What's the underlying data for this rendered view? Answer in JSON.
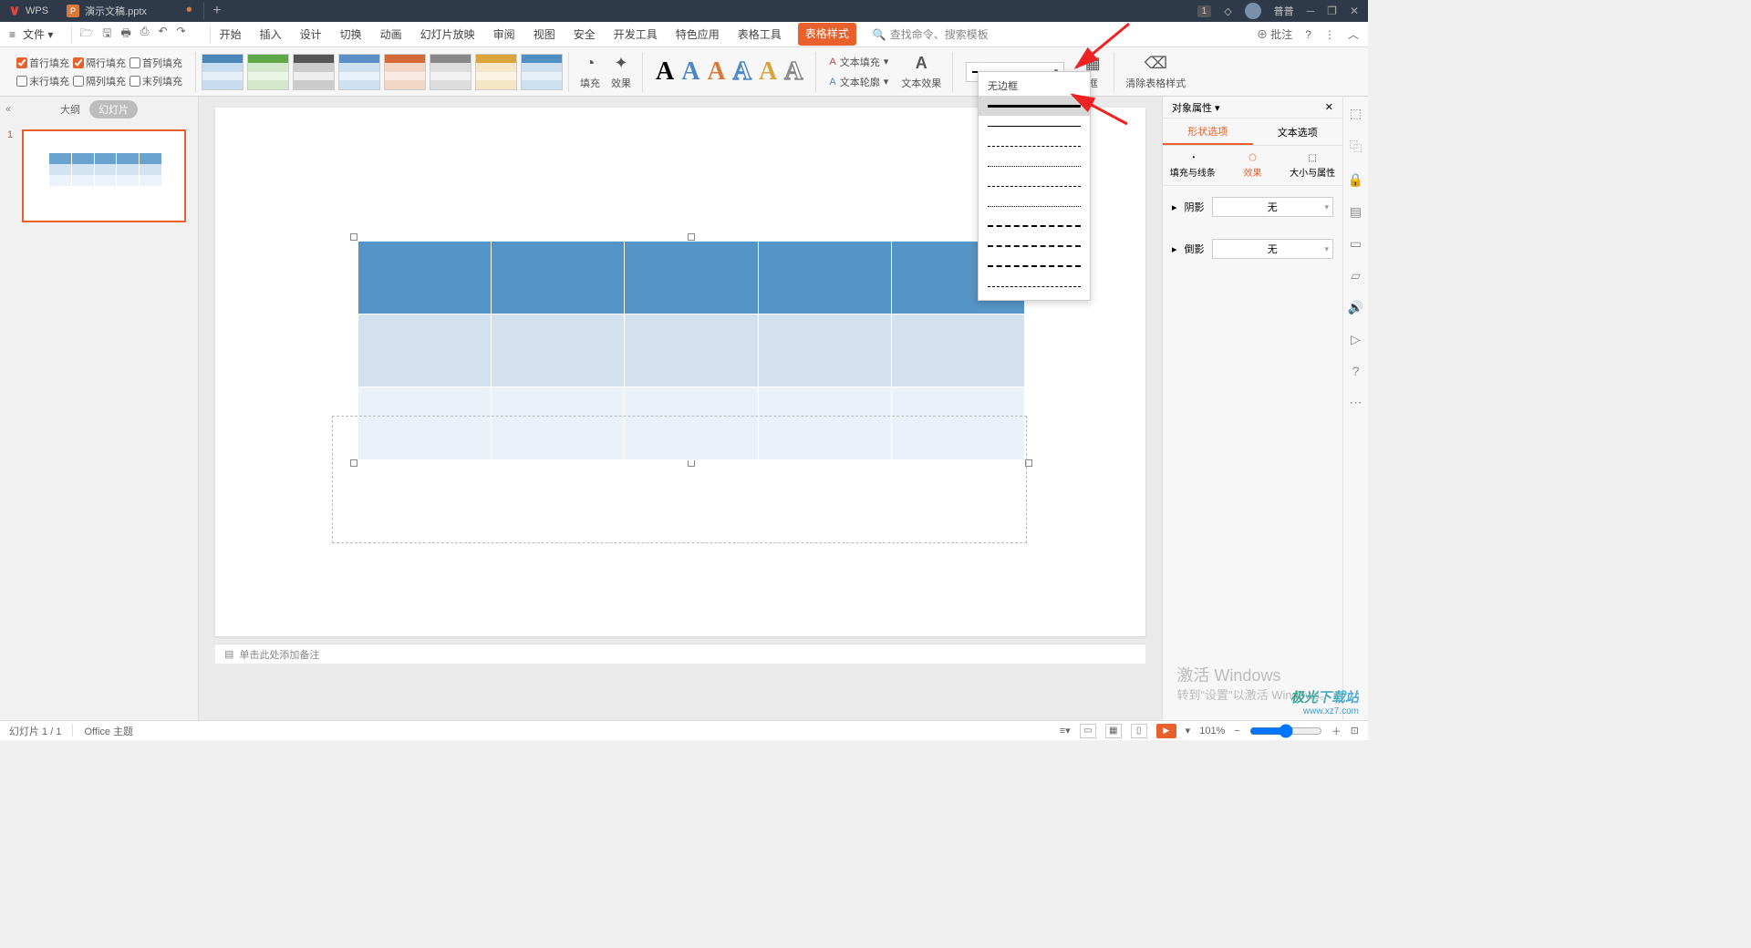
{
  "titlebar": {
    "app": "WPS",
    "tab_name": "演示文稿.pptx",
    "badge": "1",
    "username": "普普"
  },
  "menubar": {
    "file": "文件",
    "tabs": [
      "开始",
      "插入",
      "设计",
      "切换",
      "动画",
      "幻灯片放映",
      "审阅",
      "视图",
      "安全",
      "开发工具",
      "特色应用",
      "表格工具",
      "表格样式"
    ],
    "active_tab": "表格样式",
    "search_placeholder": "查找命令、搜索模板",
    "annotate": "批注"
  },
  "ribbon": {
    "checks": {
      "row1": [
        "首行填充",
        "隔行填充",
        "首列填充"
      ],
      "row2": [
        "末行填充",
        "隔列填充",
        "末列填充"
      ],
      "checked": [
        true,
        true,
        false,
        false,
        false,
        false
      ]
    },
    "fill_label": "填充",
    "effect_label": "效果",
    "text_fill": "文本填充",
    "text_outline": "文本轮廓",
    "text_effect": "文本效果",
    "border_frame": "框",
    "clear_style": "清除表格样式",
    "no_border": "无边框"
  },
  "thumb": {
    "outline": "大纲",
    "slides": "幻灯片",
    "num": "1"
  },
  "canvas": {
    "notes_hint": "单击此处添加备注"
  },
  "right_panel": {
    "title": "对象属性",
    "tab_shape": "形状选项",
    "tab_text": "文本选项",
    "sub_fill": "填充与线条",
    "sub_effect": "效果",
    "sub_size": "大小与属性",
    "shadow": "阴影",
    "bevel": "倒影",
    "none": "无"
  },
  "statusbar": {
    "slide_info": "幻灯片 1 / 1",
    "theme": "Office 主题",
    "zoom": "101%"
  },
  "activate": {
    "line1": "激活 Windows",
    "line2": "转到\"设置\"以激活 Windows。"
  },
  "watermark": {
    "line1": "极光下载站",
    "line2": "www.xz7.com"
  }
}
